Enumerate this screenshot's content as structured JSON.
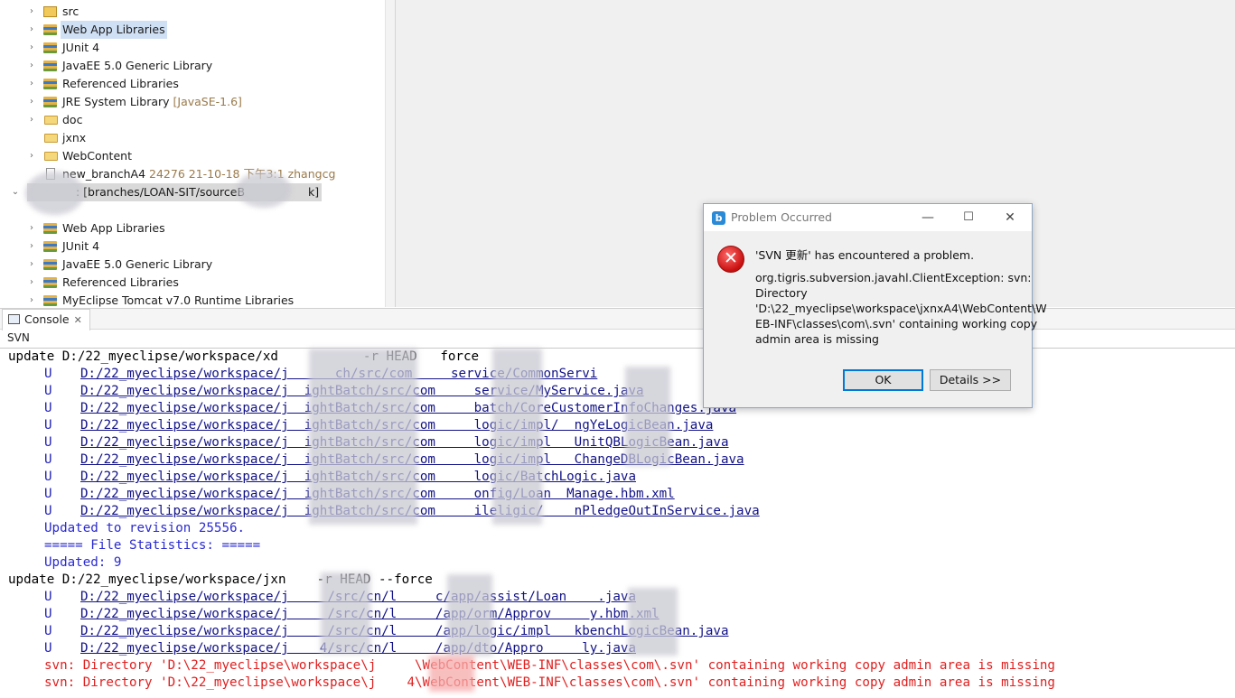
{
  "explorer": {
    "rows": [
      {
        "label": "src",
        "extra": ""
      },
      {
        "label": "Web App Libraries",
        "extra": ""
      },
      {
        "label": "JUnit 4",
        "extra": ""
      },
      {
        "label": "JavaEE 5.0 Generic Library",
        "extra": ""
      },
      {
        "label": "Referenced Libraries",
        "extra": ""
      },
      {
        "label": "JRE System Library",
        "extra": "[JavaSE-1.6]"
      },
      {
        "label": "doc",
        "extra": ""
      },
      {
        "label": "jxnx",
        "extra": ""
      },
      {
        "label": "WebContent",
        "extra": ""
      },
      {
        "label": "new_branchA4",
        "extra": "24276  21-10-18 下午3:1  zhangcg"
      },
      {
        "label": ": [branches/LOAN-SIT/sourceB",
        "extra": "k]"
      },
      {
        "label": "Web App Libraries",
        "extra": ""
      },
      {
        "label": "JUnit 4",
        "extra": ""
      },
      {
        "label": "JavaEE 5.0 Generic Library",
        "extra": ""
      },
      {
        "label": "Referenced Libraries",
        "extra": ""
      },
      {
        "label": "MyEclipse Tomcat v7.0 Runtime Libraries",
        "extra": ""
      }
    ]
  },
  "console": {
    "tab_label": "Console",
    "tab_close": "✕",
    "header": "SVN",
    "lines": {
      "l0": "update D:/22_myeclipse/workspace/xd           -r HEAD   force",
      "l1s": "U",
      "l1f": "D:/22_myeclipse/workspace/j      ch/src/com     service/CommonServi",
      "l2s": "U",
      "l2f": "D:/22_myeclipse/workspace/j  ightBatch/src/com     service/MyService.java",
      "l3s": "U",
      "l3f": "D:/22_myeclipse/workspace/j  ightBatch/src/com     batch/CoreCustomerInfoChanges.java",
      "l4s": "U",
      "l4f": "D:/22_myeclipse/workspace/j  ightBatch/src/com     logic/impl/  ngYeLogicBean.java",
      "l5s": "U",
      "l5f": "D:/22_myeclipse/workspace/j  ightBatch/src/com     logic/impl   UnitQBLogicBean.java",
      "l6s": "U",
      "l6f": "D:/22_myeclipse/workspace/j  ightBatch/src/com     logic/impl   ChangeDBLogicBean.java",
      "l7s": "U",
      "l7f": "D:/22_myeclipse/workspace/j  ightBatch/src/com     logic/BatchLogic.java",
      "l8s": "U",
      "l8f": "D:/22_myeclipse/workspace/j  ightBatch/src/com     onfig/Loan  Manage.hbm.xml",
      "l9s": "U",
      "l9f": "D:/22_myeclipse/workspace/j  ightBatch/src/com     ileligic/    nPledgeOutInService.java",
      "l10": "Updated to revision 25556.",
      "l11": "===== File Statistics: =====",
      "l12": "Updated: 9",
      "l13": "update D:/22_myeclipse/workspace/jxn    -r HEAD --force",
      "l14s": "U",
      "l14f": "D:/22_myeclipse/workspace/j     /src/cn/l     c/app/assist/Loan    .java",
      "l15s": "U",
      "l15f": "D:/22_myeclipse/workspace/j     /src/cn/l     /app/orm/Approv     y.hbm.xml",
      "l16s": "U",
      "l16f": "D:/22_myeclipse/workspace/j     /src/cn/l     /app/logic/impl   kbenchLogicBean.java",
      "l17s": "U",
      "l17f": "D:/22_myeclipse/workspace/j    4/src/cn/l     /app/dto/Appro     ly.java",
      "l18": "svn: Directory 'D:\\22_myeclipse\\workspace\\j     \\WebContent\\WEB-INF\\classes\\com\\.svn' containing working copy admin area is missing",
      "l19": "svn: Directory 'D:\\22_myeclipse\\workspace\\j    4\\WebContent\\WEB-INF\\classes\\com\\.svn' containing working copy admin area is missing"
    }
  },
  "dialog": {
    "title": "Problem Occurred",
    "app_icon": "b",
    "minimize": "—",
    "maximize": "☐",
    "close": "✕",
    "error_glyph": "✕",
    "headline": "'SVN 更新' has encountered a problem.",
    "message": "org.tigris.subversion.javahl.ClientException: svn:\nDirectory\n'D:\\22_myeclipse\\workspace\\jxnxA4\\WebContent\\W\nEB-INF\\classes\\com\\.svn' containing working copy\nadmin area is missing",
    "ok_label": "OK",
    "details_label": "Details >>"
  },
  "colors": {
    "console_file": "#1f1fb8",
    "console_error": "#e02020",
    "console_info": "#2a2ad0"
  }
}
